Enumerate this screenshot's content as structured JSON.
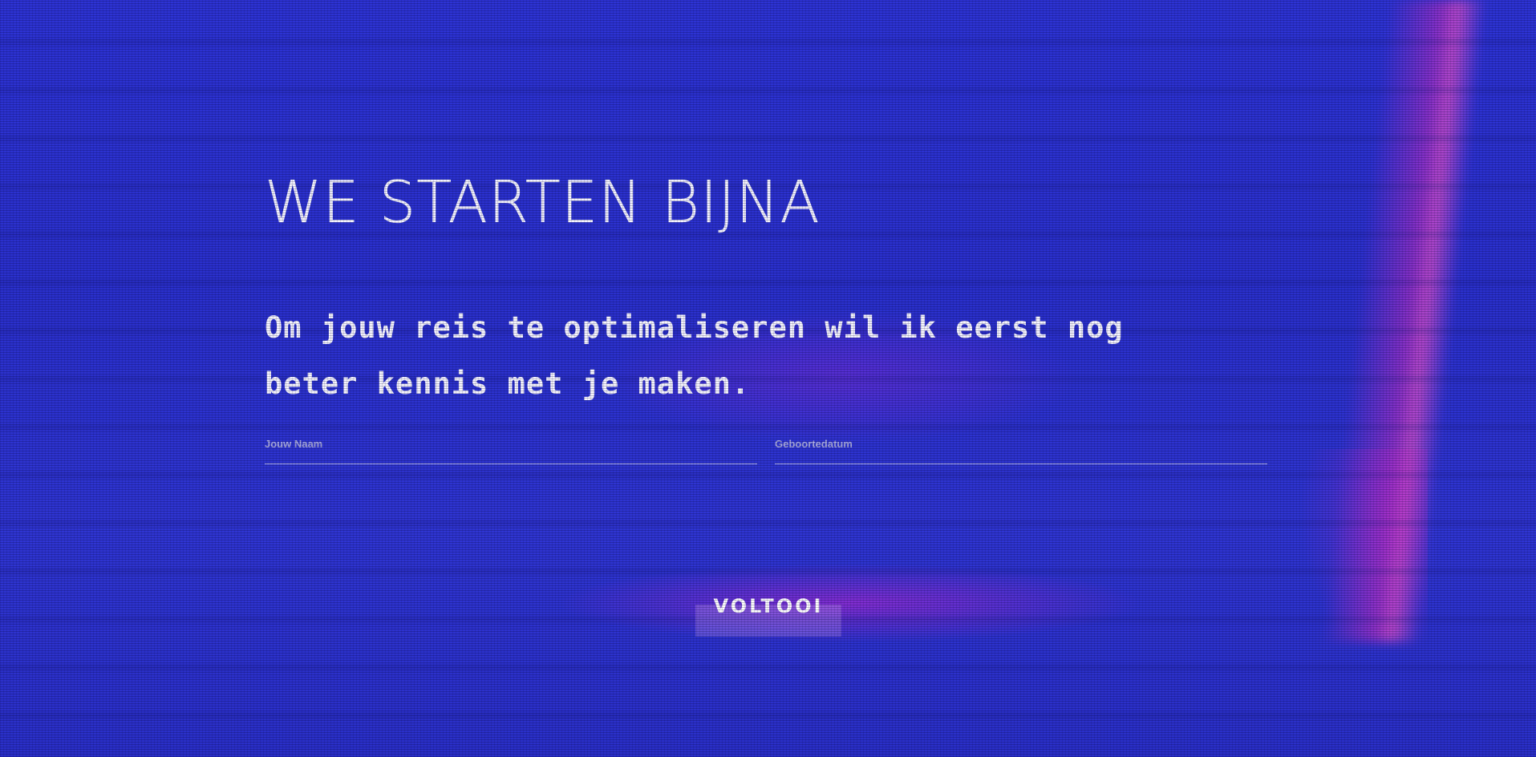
{
  "page": {
    "title": "WE STARTEN BIJNA",
    "intro": "Om jouw reis te optimaliseren wil ik eerst nog beter kennis met je maken."
  },
  "form": {
    "name_label": "Jouw Naam",
    "name_value": "",
    "birthdate_label": "Geboortedatum",
    "birthdate_value": "",
    "submit_label": "VOLTOOI"
  },
  "colors": {
    "background": "#2a2fd0",
    "accent_glow": "#d22dbe",
    "text": "#ffffff"
  }
}
